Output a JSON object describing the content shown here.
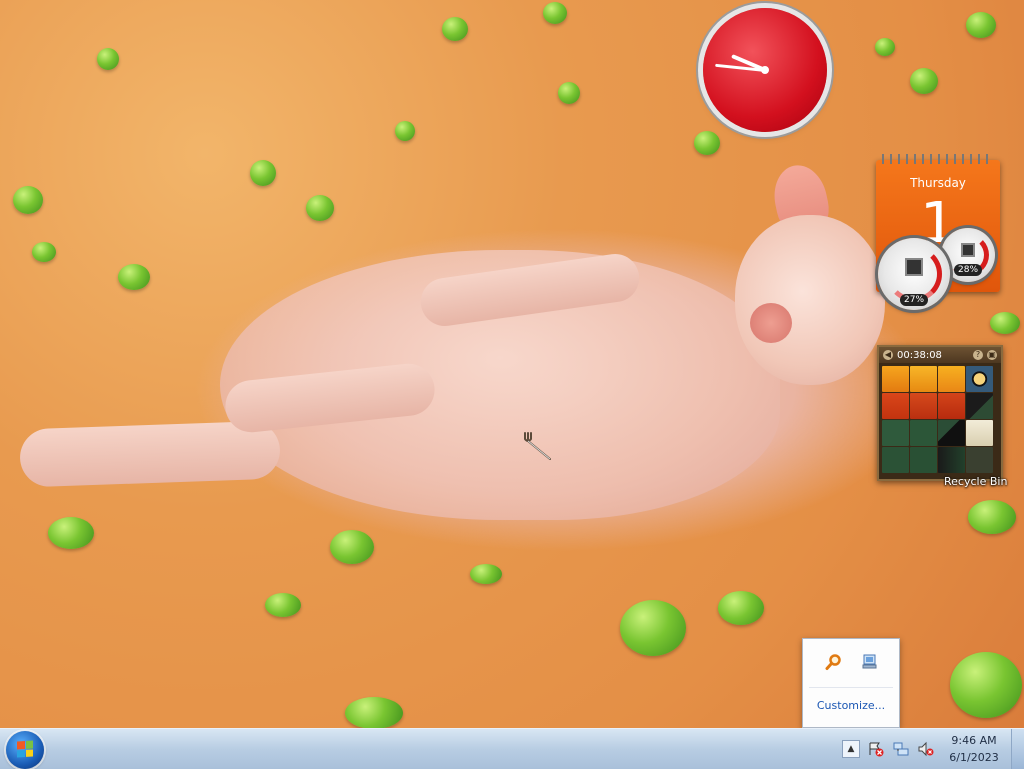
{
  "desktop": {
    "gadgets": {
      "clock": {
        "hour": 9,
        "minute": 46
      },
      "calendar": {
        "weekday": "Thursday",
        "date": "1"
      },
      "cpu_meter": {
        "cpu_percent": "27%",
        "memory_percent": "28%"
      },
      "picture_puzzle": {
        "timer": "00:38:08",
        "help_icon": "help-icon",
        "view_icon": "view-icon"
      }
    },
    "icons": [
      {
        "label": "Recycle Bin"
      }
    ]
  },
  "notification_overflow": {
    "icons": [
      "search-icon",
      "network-icon"
    ],
    "customize_label": "Customize..."
  },
  "taskbar": {
    "start_button": "start-orb",
    "tray_icons": [
      "show-hidden-icons",
      "action-center-icon",
      "network-icon",
      "volume-muted-icon"
    ],
    "time": "9:46 AM",
    "date": "6/1/2023"
  }
}
